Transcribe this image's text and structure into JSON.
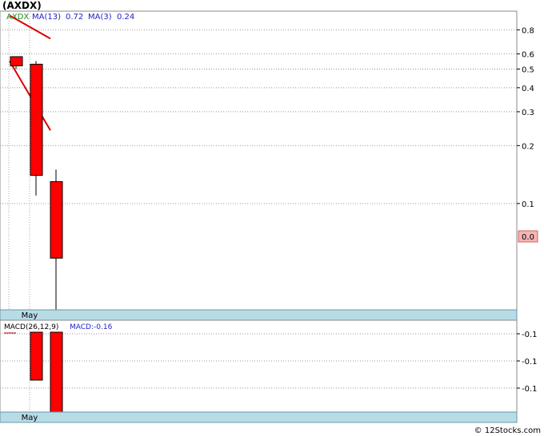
{
  "title": "(AXDX)",
  "footer": "© 12Stocks.com",
  "legend": {
    "ticker": "AXDX",
    "ma13_label": "MA(13)",
    "ma13_value": "0.72",
    "ma3_label": "MA(3)",
    "ma3_value": "0.24"
  },
  "macd_legend": {
    "label": "MACD(26,12,9)",
    "value_label": "MACD:-0.16"
  },
  "colors": {
    "candle": "#ff0000",
    "ma_line": "#dd0000",
    "axis_band": "#b8dce6",
    "last_price_bg": "#f4b4b4",
    "ticker_text": "#228822",
    "legend_text": "#2222cc"
  },
  "chart_data": [
    {
      "type": "candlestick",
      "scale": "log",
      "x_tick_labels": [
        "May"
      ],
      "y_tick_labels": [
        "0.8",
        "0.6",
        "0.5",
        "0.4",
        "0.3",
        "0.2",
        "0.1"
      ],
      "y_ticks": [
        0.8,
        0.6,
        0.5,
        0.4,
        0.3,
        0.2,
        0.1
      ],
      "ylim": [
        0.028,
        1.0
      ],
      "last_price_label": "0.0",
      "last_price": 0.052,
      "candles": [
        {
          "x": 0,
          "open": 0.58,
          "close": 0.52,
          "high": 0.58,
          "low": 0.5
        },
        {
          "x": 1,
          "open": 0.53,
          "close": 0.14,
          "high": 0.55,
          "low": 0.11
        },
        {
          "x": 2,
          "open": 0.13,
          "close": 0.052,
          "high": 0.15,
          "low": 0.028
        }
      ],
      "ma_lines": [
        {
          "name": "MA(13)",
          "points": [
            [
              0,
              0.95
            ],
            [
              2,
              0.72
            ]
          ]
        },
        {
          "name": "MA(3)",
          "points": [
            [
              0,
              0.55
            ],
            [
              2,
              0.24
            ]
          ]
        }
      ]
    },
    {
      "type": "bar",
      "title": "MACD(26,12,9)",
      "x_tick_labels": [
        "May"
      ],
      "y_tick_labels": [
        "-0.1",
        "-0.1",
        "-0.1"
      ],
      "ylim": [
        -0.2,
        0.0
      ],
      "series": [
        {
          "name": "MACD",
          "values": [
            0.0,
            -0.12,
            -0.2
          ]
        }
      ]
    }
  ]
}
